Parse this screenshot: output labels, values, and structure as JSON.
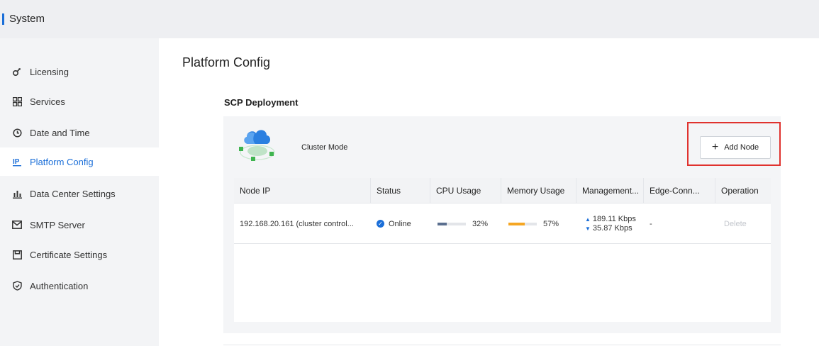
{
  "header": {
    "title": "System"
  },
  "sidebar": {
    "items": [
      {
        "label": "Licensing",
        "icon": "key-icon"
      },
      {
        "label": "Services",
        "icon": "grid-icon"
      },
      {
        "label": "Date and Time",
        "icon": "clock-icon"
      },
      {
        "label": "Platform Config",
        "icon": "ip-icon",
        "active": true
      },
      {
        "label": "Data Center Settings",
        "icon": "bar-chart-icon"
      },
      {
        "label": "SMTP Server",
        "icon": "mail-icon"
      },
      {
        "label": "Certificate Settings",
        "icon": "certificate-icon"
      },
      {
        "label": "Authentication",
        "icon": "shield-icon"
      }
    ]
  },
  "main": {
    "title": "Platform Config",
    "section_title": "SCP Deployment",
    "cluster_mode": "Cluster Mode",
    "add_node_label": "Add Node",
    "table": {
      "columns": [
        "Node IP",
        "Status",
        "CPU Usage",
        "Memory Usage",
        "Management...",
        "Edge-Conn...",
        "Operation"
      ],
      "rows": [
        {
          "node_ip": "192.168.20.161 (cluster control...",
          "status": "Online",
          "cpu": "32%",
          "cpu_fraction": 0.32,
          "memory": "57%",
          "memory_fraction": 0.57,
          "upload": "189.11 Kbps",
          "download": "35.87 Kbps",
          "edge": "-",
          "operation": "Delete"
        }
      ]
    }
  },
  "colors": {
    "accent": "#1a6ed8",
    "cpu_bar": "#5b6f8f",
    "memory_bar": "#f5a623",
    "highlight": "#e0322e"
  }
}
